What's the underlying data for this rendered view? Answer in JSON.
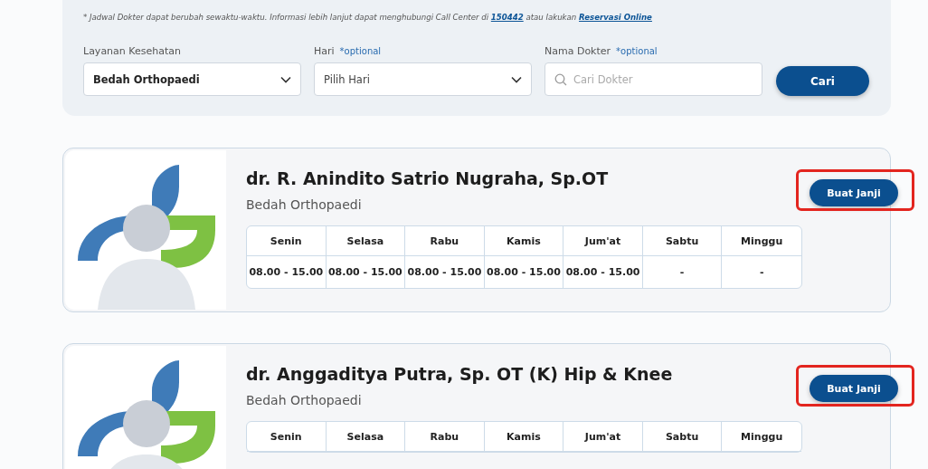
{
  "filter": {
    "note": {
      "text": "* Jadwal Dokter dapat berubah sewaktu-waktu. Informasi lebih lanjut dapat menghubungi Call Center di ",
      "phone": "150442",
      "middle": " atau lakukan ",
      "link": "Reservasi Online"
    },
    "fields": [
      {
        "kind": "select",
        "label": "Layanan Kesehatan",
        "value": "Bedah Orthopaedi"
      },
      {
        "kind": "select",
        "label": "Hari",
        "optional": "*optional",
        "placeholder": "Pilih Hari"
      },
      {
        "kind": "search",
        "label": "Nama Dokter",
        "optional": "*optional",
        "placeholder": "Cari Dokter"
      }
    ],
    "button": "Cari"
  },
  "doctors": [
    {
      "name": "dr. R. Anindito Satrio Nugraha, Sp.OT",
      "specialty": "Bedah Orthopaedi",
      "button": "Buat Janji",
      "highlighted": true,
      "schedule": {
        "days": [
          "Senin",
          "Selasa",
          "Rabu",
          "Kamis",
          "Jum'at",
          "Sabtu",
          "Minggu"
        ],
        "hours": [
          "08.00 - 15.00",
          "08.00 - 15.00",
          "08.00 - 15.00",
          "08.00 - 15.00",
          "08.00 - 15.00",
          "-",
          "-"
        ]
      }
    },
    {
      "name": "dr. Anggaditya Putra, Sp. OT (K) Hip & Knee",
      "specialty": "Bedah Orthopaedi",
      "button": "Buat Janji",
      "highlighted": true,
      "schedule": {
        "days": [
          "Senin",
          "Selasa",
          "Rabu",
          "Kamis",
          "Jum'at",
          "Sabtu",
          "Minggu"
        ]
      }
    }
  ]
}
